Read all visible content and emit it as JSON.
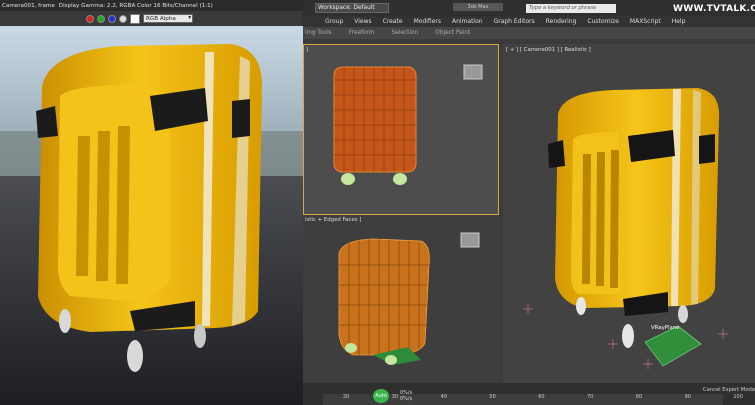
{
  "frame_buffer": {
    "tab_label": "Camera001, frame",
    "display_info": "Display Gamma: 2.2, RGBA Color 16 Bits/Channel (1:1)",
    "channel_select": "RGB Alpha"
  },
  "max": {
    "workspace": "Workspace: Default",
    "title": "3ds Max",
    "search_placeholder": "Type a keyword or phrase",
    "watermark": "WWW.TVTALK.CN",
    "menu": [
      "Group",
      "Views",
      "Create",
      "Modifiers",
      "Animation",
      "Graph Editors",
      "Rendering",
      "Customize",
      "MAXScript",
      "Help"
    ],
    "ribbon": [
      "ling Tools",
      "Freeform",
      "Selection",
      "Object Paint"
    ],
    "viewports": {
      "top_label": "]",
      "persp_label": "lstic + Edged Faces ]",
      "camera_label": "[ + ] [ Camera001 ] [ Realistic ]",
      "helper_label": "VRayPlane"
    },
    "status": "Cancel Expert Mode",
    "playback_label": "Auto",
    "coord_1": "0%/s",
    "coord_2": "0%/s",
    "timeline_ticks": [
      "20",
      "30",
      "40",
      "50",
      "60",
      "70",
      "80",
      "90",
      "100"
    ]
  },
  "colors": {
    "suitcase_yellow": "#f2b705",
    "wire_orange": "#d9661c",
    "vray_green": "#2f8f3a"
  }
}
